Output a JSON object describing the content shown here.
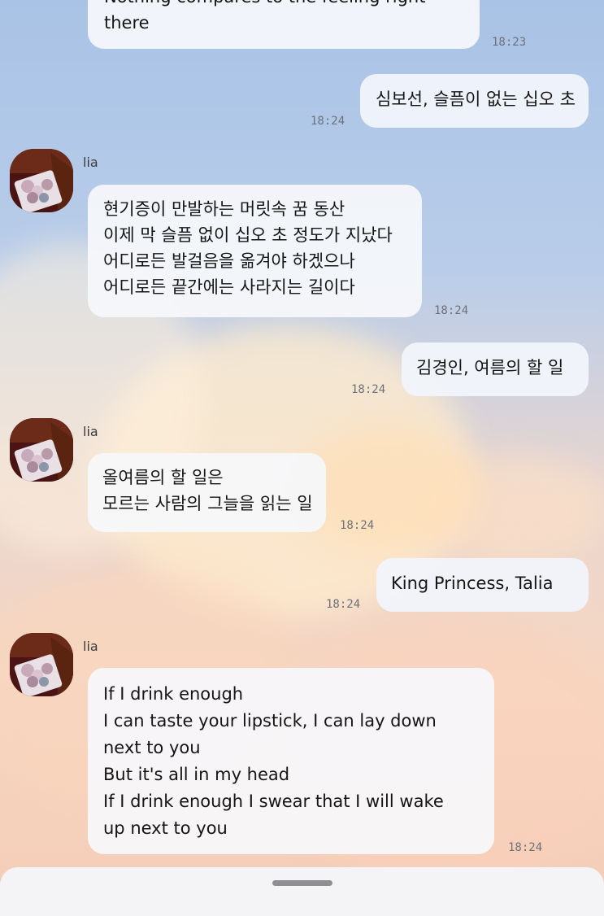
{
  "chat": {
    "messages": [
      {
        "type": "sent_partial",
        "lines": [
          "Nothing compares to the feeling right",
          "there"
        ],
        "time": "18:23"
      },
      {
        "type": "sent",
        "lines": [
          "심보선, 슬픔이 없는 십오 초"
        ],
        "time": "18:24"
      },
      {
        "type": "received",
        "sender": "lia",
        "lines": [
          "현기증이 만발하는 머릿속 꿈 동산",
          "이제 막 슬픔 없이 십오 초 정도가 지났다",
          "어디로든 발걸음을 옮겨야 하겠으나",
          "어디로든 끝간에는 사라지는 길이다"
        ],
        "time": "18:24"
      },
      {
        "type": "sent",
        "lines": [
          "김경인, 여름의 할 일"
        ],
        "time": "18:24"
      },
      {
        "type": "received",
        "sender": "lia",
        "lines": [
          "올여름의 할 일은",
          "모르는 사람의 그늘을 읽는 일"
        ],
        "time": "18:24"
      },
      {
        "type": "sent",
        "lines": [
          "King Princess, Talia"
        ],
        "time": "18:24"
      },
      {
        "type": "received",
        "sender": "lia",
        "lines": [
          "If I drink enough",
          "I can taste your lipstick, I can lay down",
          "next to you",
          "But it's all in my head",
          "If I drink enough I swear that I will wake",
          "up next to you"
        ],
        "time": "18:24"
      }
    ]
  },
  "colors": {
    "bubble": "#f6f7fb",
    "text": "#151515",
    "time": "#6d7179",
    "avatar_bg": "#4a1414"
  },
  "icons": {
    "avatar": "profile-photo-roses",
    "handle": "bottom-sheet-handle"
  }
}
